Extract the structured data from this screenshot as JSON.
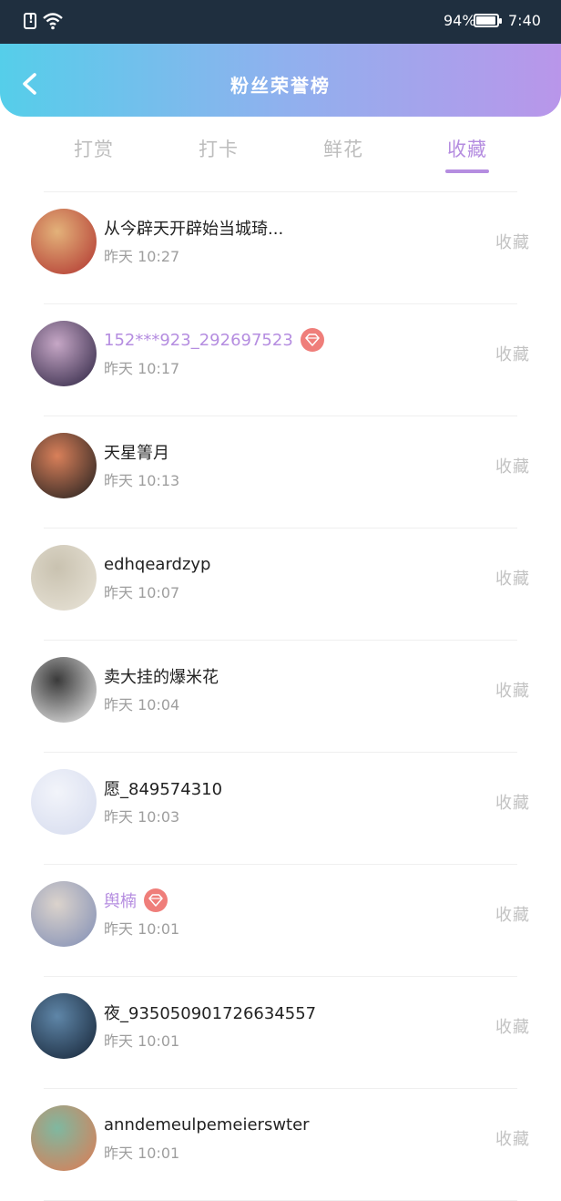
{
  "status_bar": {
    "battery": "94%",
    "time": "7:40"
  },
  "header": {
    "title": "粉丝荣誉榜"
  },
  "tabs": [
    {
      "label": "打赏",
      "active": false
    },
    {
      "label": "打卡",
      "active": false
    },
    {
      "label": "鲜花",
      "active": false
    },
    {
      "label": "收藏",
      "active": true
    }
  ],
  "list": [
    {
      "name": "从今辟天开辟始当城琦...",
      "time": "昨天 10:27",
      "action": "收藏",
      "vip": false,
      "avatar_colors": [
        "#b0322e",
        "#e3b27a"
      ]
    },
    {
      "name": "152***923_292697523",
      "time": "昨天 10:17",
      "action": "收藏",
      "vip": true,
      "avatar_colors": [
        "#2a2140",
        "#c6a7c6"
      ]
    },
    {
      "name": "天星箐月",
      "time": "昨天 10:13",
      "action": "收藏",
      "vip": false,
      "avatar_colors": [
        "#1d1d1d",
        "#d9805a"
      ]
    },
    {
      "name": "edhqeardzyp",
      "time": "昨天 10:07",
      "action": "收藏",
      "vip": false,
      "avatar_colors": [
        "#e9e4d8",
        "#c9c2b0"
      ]
    },
    {
      "name": "卖大挂的爆米花",
      "time": "昨天 10:04",
      "action": "收藏",
      "vip": false,
      "avatar_colors": [
        "#f1f1f1",
        "#3a3a3a"
      ]
    },
    {
      "name": "愿_849574310",
      "time": "昨天 10:03",
      "action": "收藏",
      "vip": false,
      "avatar_colors": [
        "#d5dbee",
        "#f2f4fa"
      ]
    },
    {
      "name": "舆楠",
      "time": "昨天 10:01",
      "action": "收藏",
      "vip": true,
      "avatar_colors": [
        "#7f8db5",
        "#dbd3cc"
      ]
    },
    {
      "name": "夜_935050901726634557",
      "time": "昨天 10:01",
      "action": "收藏",
      "vip": false,
      "avatar_colors": [
        "#142234",
        "#5f86a8"
      ]
    },
    {
      "name": "anndemeulpemeierswter",
      "time": "昨天 10:01",
      "action": "收藏",
      "vip": false,
      "avatar_colors": [
        "#e07a52",
        "#7fb8a0"
      ]
    }
  ],
  "colors": {
    "accent": "#b58de0",
    "header_gradient": [
      "#55ceea",
      "#b996ea"
    ],
    "vip_badge": "#ef7e7a"
  }
}
